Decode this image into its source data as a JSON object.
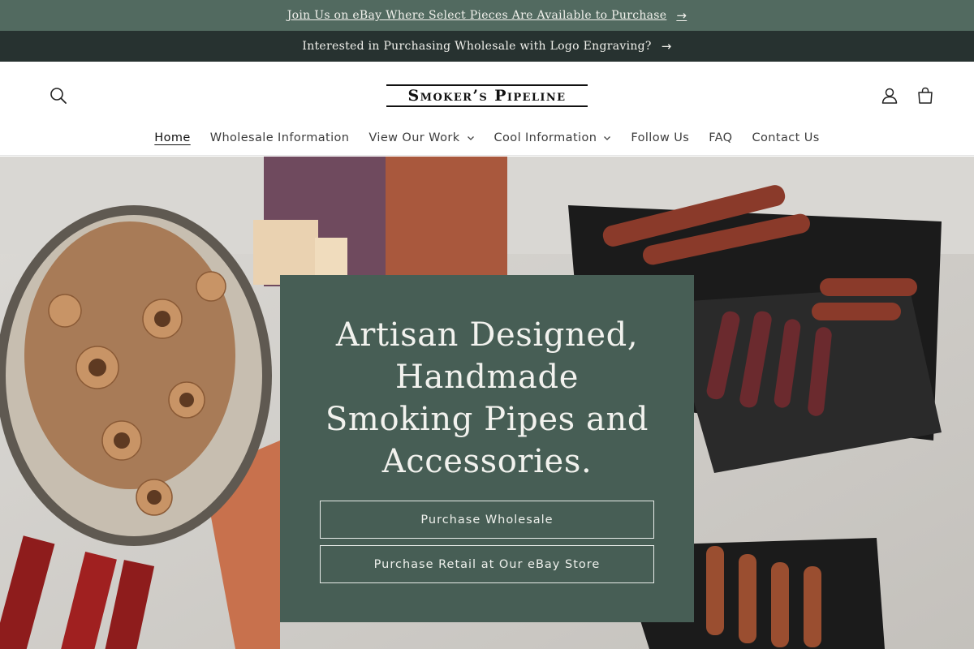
{
  "announcements": [
    {
      "text": "Join Us on eBay Where Select Pieces Are Available to Purchase",
      "arrow": "→"
    },
    {
      "text": "Interested in Purchasing Wholesale with Logo Engraving?",
      "arrow": "→"
    }
  ],
  "header": {
    "logo_text": "Smoker’s Pipeline",
    "icons": {
      "search": "search-icon",
      "account": "account-icon",
      "cart": "cart-icon"
    }
  },
  "nav": {
    "items": [
      {
        "label": "Home",
        "active": true,
        "has_dropdown": false
      },
      {
        "label": "Wholesale Information",
        "active": false,
        "has_dropdown": false
      },
      {
        "label": "View Our Work",
        "active": false,
        "has_dropdown": true
      },
      {
        "label": "Cool Information",
        "active": false,
        "has_dropdown": true
      },
      {
        "label": "Follow Us",
        "active": false,
        "has_dropdown": false
      },
      {
        "label": "FAQ",
        "active": false,
        "has_dropdown": false
      },
      {
        "label": "Contact Us",
        "active": false,
        "has_dropdown": false
      }
    ]
  },
  "hero": {
    "title": "Artisan Designed, Handmade Smoking Pipes and Accessories.",
    "buttons": [
      {
        "label": "Purchase Wholesale"
      },
      {
        "label": "Purchase Retail at Our eBay Store"
      }
    ]
  },
  "colors": {
    "announcement_1": "#526a60",
    "announcement_2": "#273230",
    "hero_card": "#475e55",
    "text_light": "#f2f2ee"
  }
}
